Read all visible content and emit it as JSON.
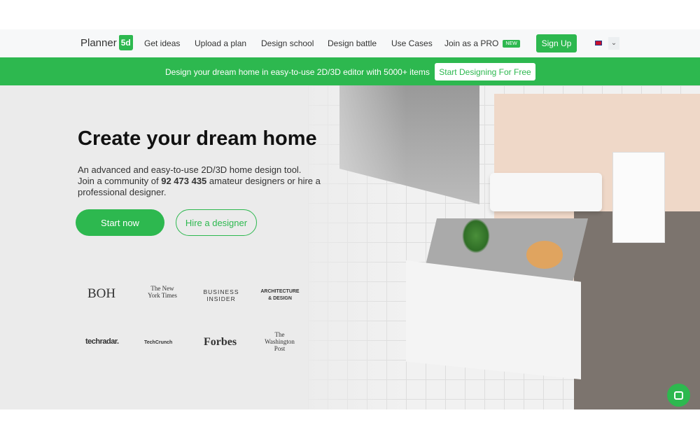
{
  "nav": {
    "logo_text": "Planner",
    "logo_badge": "5d",
    "links": [
      "Get ideas",
      "Upload a plan",
      "Design school",
      "Design battle",
      "Use Cases",
      "Join as a PRO"
    ],
    "new_badge": "NEW",
    "signup": "Sign Up",
    "language": "en-GB"
  },
  "banner": {
    "text": "Design your dream home in easy-to-use 2D/3D editor with 5000+ items",
    "button": "Start Designing For Free"
  },
  "hero": {
    "title": "Create your dream home",
    "desc_1": "An advanced and easy-to-use 2D/3D home design tool.",
    "desc_2": "Join a community of ",
    "count": "92 473 435",
    "desc_3": " amateur designers or hire a professional designer.",
    "start": "Start now",
    "hire": "Hire a designer"
  },
  "press": [
    "BOH",
    "The New York Times",
    "BUSINESS INSIDER",
    "ARCHITECTURE & DESIGN",
    "techradar.",
    "TechCrunch",
    "Forbes",
    "The Washington Post"
  ],
  "colors": {
    "accent": "#2db84f"
  }
}
